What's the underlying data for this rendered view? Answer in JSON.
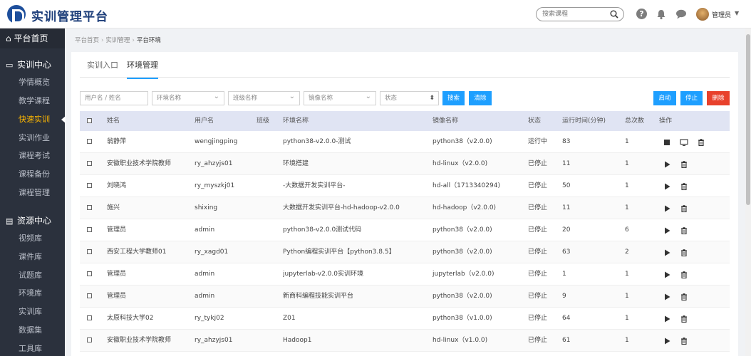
{
  "app": {
    "title": "实训管理平台"
  },
  "header": {
    "search_placeholder": "搜索课程",
    "user_name": "管理员",
    "icons": [
      "search-icon",
      "help-icon",
      "bell-icon",
      "chat-icon",
      "chevron-down-icon"
    ]
  },
  "sidebar": {
    "home": "平台首页",
    "sections": [
      {
        "label": "实训中心",
        "icon": "monitor-icon",
        "items": [
          "学情概览",
          "教学课程",
          "快速实训",
          "实训作业",
          "课程考试",
          "课程备份",
          "课程管理"
        ]
      },
      {
        "label": "资源中心",
        "icon": "drive-icon",
        "items": [
          "视频库",
          "课件库",
          "试题库",
          "环境库",
          "实训库",
          "数据集",
          "工具库"
        ]
      }
    ],
    "active_item": "快速实训",
    "active_color": "#ffb800"
  },
  "breadcrumb": [
    "平台首页",
    "实训管理",
    "平台环境"
  ],
  "tabs": [
    "实训入口",
    "环境管理"
  ],
  "filters": {
    "user_placeholder": "用户名 / 姓名",
    "env_placeholder": "环境名称",
    "class_placeholder": "班级名称",
    "image_placeholder": "镜像名称",
    "status_placeholder": "状态",
    "search_button": "搜索",
    "clear_button": "清除",
    "start_button": "启动",
    "stop_button": "停止",
    "delete_button": "删除"
  },
  "table": {
    "headers": [
      "姓名",
      "用户名",
      "班级",
      "环境名称",
      "镜像名称",
      "状态",
      "运行时间(分钟)",
      "总次数",
      "操作"
    ],
    "rows": [
      {
        "name": "翁静萍",
        "username": "wengjingping",
        "class": "",
        "env": "python38-v2.0.0-测试",
        "image": "python38（v2.0.0)",
        "status": "运行中",
        "runtime": "83",
        "count": "1",
        "running": true
      },
      {
        "name": "安徽职业技术学院教师",
        "username": "ry_ahzyjs01",
        "class": "",
        "env": "环境搭建",
        "image": "hd-linux（v2.0.0)",
        "status": "已停止",
        "runtime": "11",
        "count": "1",
        "running": false
      },
      {
        "name": "刘晓鸿",
        "username": "ry_myszkj01",
        "class": "",
        "env": "-大数据开发实训平台-",
        "image": "hd-all（1713340294)",
        "status": "已停止",
        "runtime": "50",
        "count": "1",
        "running": false
      },
      {
        "name": "施兴",
        "username": "shixing",
        "class": "",
        "env": "大数据开发实训平台-hd-hadoop-v2.0.0",
        "image": "hd-hadoop（v2.0.0)",
        "status": "已停止",
        "runtime": "11",
        "count": "1",
        "running": false
      },
      {
        "name": "管理员",
        "username": "admin",
        "class": "",
        "env": "python38-v2.0.0测试代码",
        "image": "python38（v2.0.0)",
        "status": "已停止",
        "runtime": "20",
        "count": "6",
        "running": false
      },
      {
        "name": "西安工程大学教师01",
        "username": "ry_xagd01",
        "class": "",
        "env": "Python编程实训平台【python3.8.5】",
        "image": "python38（v2.0.0)",
        "status": "已停止",
        "runtime": "63",
        "count": "2",
        "running": false
      },
      {
        "name": "管理员",
        "username": "admin",
        "class": "",
        "env": "jupyterlab-v2.0.0实训环境",
        "image": "jupyterlab（v2.0.0)",
        "status": "已停止",
        "runtime": "1",
        "count": "1",
        "running": false
      },
      {
        "name": "管理员",
        "username": "admin",
        "class": "",
        "env": "新商科编程技能实训平台",
        "image": "python38（v2.0.0)",
        "status": "已停止",
        "runtime": "9",
        "count": "1",
        "running": false
      },
      {
        "name": "太原科技大学02",
        "username": "ry_tykj02",
        "class": "",
        "env": "Z01",
        "image": "python38（v1.0.0)",
        "status": "已停止",
        "runtime": "64",
        "count": "1",
        "running": false
      },
      {
        "name": "安徽职业技术学院教师",
        "username": "ry_ahzyjs01",
        "class": "",
        "env": "Hadoop1",
        "image": "hd-linux（v1.0.0)",
        "status": "已停止",
        "runtime": "61",
        "count": "1",
        "running": false
      }
    ]
  },
  "colors": {
    "primary": "#1e9fff",
    "danger": "#e8412c",
    "sidebar": "#2b313d",
    "header_row": "#e0e4f3"
  }
}
